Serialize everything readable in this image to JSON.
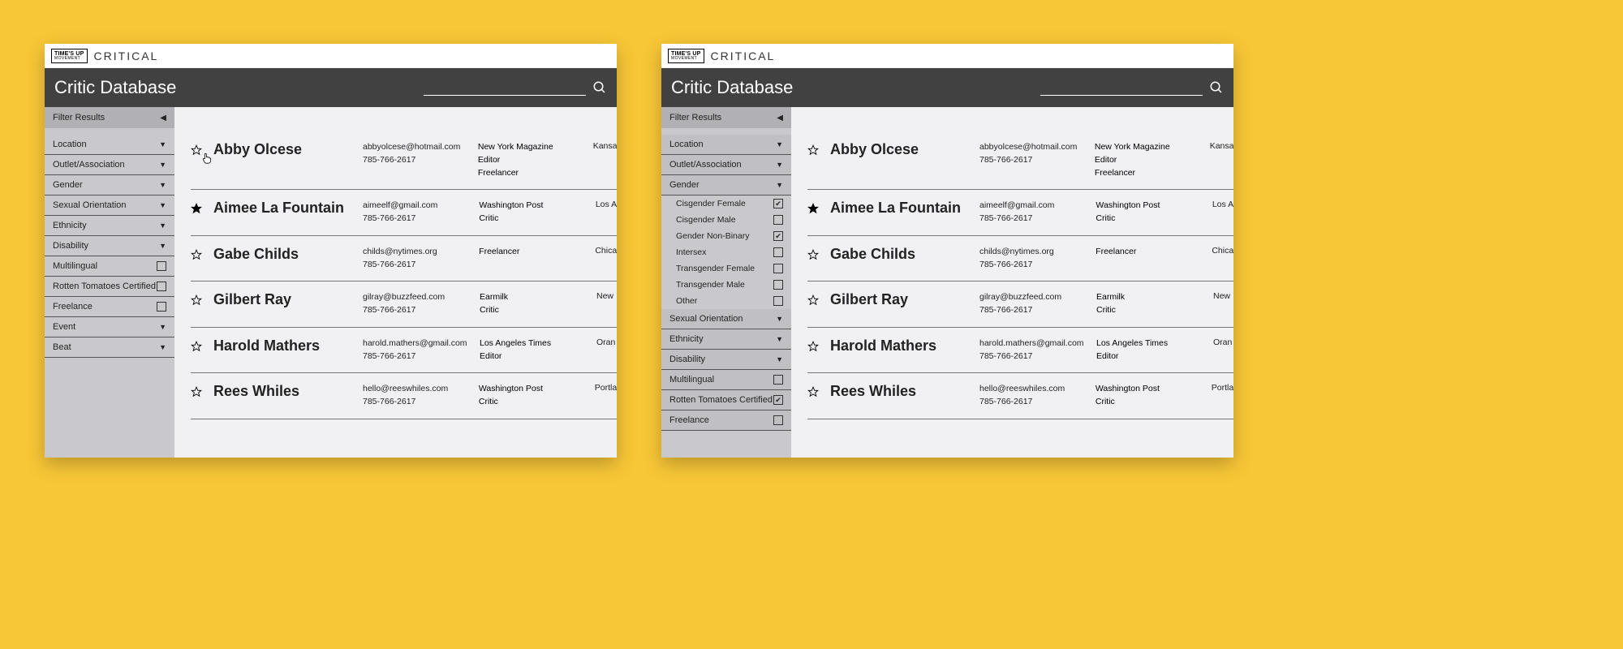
{
  "brand": {
    "logo_line1": "TIME'S",
    "logo_line2": "UP",
    "logo_tag": "MOVEMENT",
    "product": "CRITICAL"
  },
  "header": {
    "title": "Critic Database",
    "search_placeholder": ""
  },
  "sidebar": {
    "filter_label": "Filter Results",
    "filters_collapsed": [
      {
        "label": "Location",
        "type": "caret"
      },
      {
        "label": "Outlet/Association",
        "type": "caret"
      },
      {
        "label": "Gender",
        "type": "caret"
      },
      {
        "label": "Sexual Orientation",
        "type": "caret"
      },
      {
        "label": "Ethnicity",
        "type": "caret"
      },
      {
        "label": "Disability",
        "type": "caret"
      },
      {
        "label": "Multilingual",
        "type": "check",
        "checked": false
      },
      {
        "label": "Rotten Tomatoes Certified",
        "type": "check",
        "checked": false
      },
      {
        "label": "Freelance",
        "type": "check",
        "checked": false
      },
      {
        "label": "Event",
        "type": "caret"
      },
      {
        "label": "Beat",
        "type": "caret"
      }
    ],
    "filters_expanded": [
      {
        "label": "Location",
        "type": "caret",
        "section": true
      },
      {
        "label": "Outlet/Association",
        "type": "caret",
        "section": true
      },
      {
        "label": "Gender",
        "type": "caret",
        "section": true,
        "expanded": true,
        "options": [
          {
            "label": "Cisgender Female",
            "checked": true
          },
          {
            "label": "Cisgender Male",
            "checked": false
          },
          {
            "label": "Gender Non-Binary",
            "checked": true
          },
          {
            "label": "Intersex",
            "checked": false
          },
          {
            "label": "Transgender Female",
            "checked": false
          },
          {
            "label": "Transgender Male",
            "checked": false
          },
          {
            "label": "Other",
            "checked": false
          }
        ]
      },
      {
        "label": "Sexual Orientation",
        "type": "caret",
        "section": true
      },
      {
        "label": "Ethnicity",
        "type": "caret",
        "section": true
      },
      {
        "label": "Disability",
        "type": "caret",
        "section": true
      },
      {
        "label": "Multilingual",
        "type": "check",
        "checked": false,
        "section": true
      },
      {
        "label": "Rotten Tomatoes Certified",
        "type": "check",
        "checked": true,
        "section": true
      },
      {
        "label": "Freelance",
        "type": "check",
        "checked": false,
        "section": true
      }
    ]
  },
  "critics": [
    {
      "fav": false,
      "name": "Abby Olcese",
      "email": "abbyolcese@hotmail.com",
      "phone": "785-766-2617",
      "outlet": "New York Magazine",
      "role": "Editor",
      "extra": "Freelancer",
      "loc": "Kansa"
    },
    {
      "fav": true,
      "name": "Aimee La Fountain",
      "email": "aimeelf@gmail.com",
      "phone": "785-766-2617",
      "outlet": "Washington Post",
      "role": "Critic",
      "extra": "",
      "loc": "Los A"
    },
    {
      "fav": false,
      "name": "Gabe Childs",
      "email": "childs@nytimes.org",
      "phone": "785-766-2617",
      "outlet": "Freelancer",
      "role": "",
      "extra": "",
      "loc": "Chica"
    },
    {
      "fav": false,
      "name": "Gilbert Ray",
      "email": "gilray@buzzfeed.com",
      "phone": "785-766-2617",
      "outlet": "Earmilk",
      "role": "Critic",
      "extra": "",
      "loc": "New"
    },
    {
      "fav": false,
      "name": "Harold Mathers",
      "email": "harold.mathers@gmail.com",
      "phone": "785-766-2617",
      "outlet": "Los Angeles Times",
      "role": "Editor",
      "extra": "",
      "loc": "Oran"
    },
    {
      "fav": false,
      "name": "Rees Whiles",
      "email": "hello@reeswhiles.com",
      "phone": "785-766-2617",
      "outlet": "Washington Post",
      "role": "Critic",
      "extra": "",
      "loc": "Portla"
    }
  ]
}
